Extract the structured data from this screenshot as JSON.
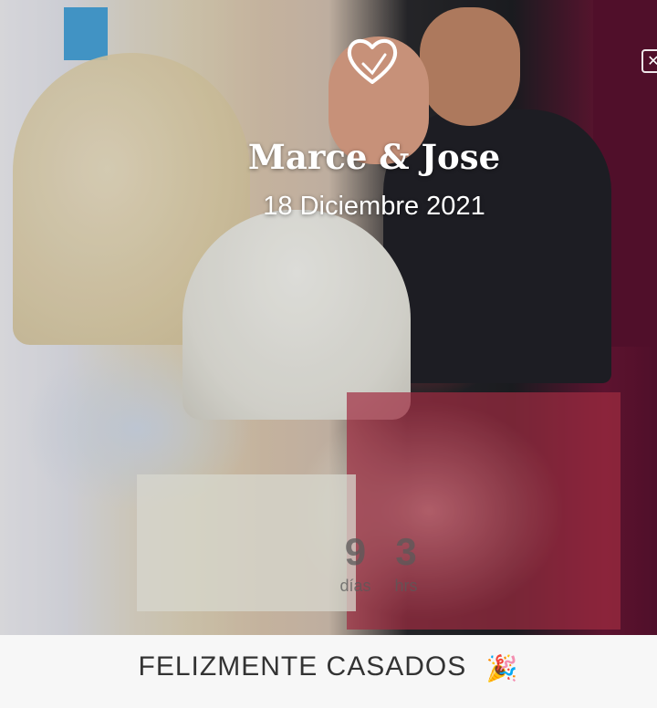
{
  "hero": {
    "names": "Marce & Jose",
    "date": "18 Diciembre 2021",
    "icon": "heart-icon",
    "close_icon": "close-icon"
  },
  "countdown": {
    "days": {
      "value": "9",
      "label": "días"
    },
    "hours": {
      "value": "3",
      "label": "hrs"
    }
  },
  "footer": {
    "status_text": "FELIZMENTE CASADOS",
    "icon": "party-popper-icon",
    "icon_glyph": "🎉"
  },
  "colors": {
    "footer_bg": "#f7f7f7",
    "text_dark": "#333333",
    "overlay_text": "#ffffff"
  }
}
